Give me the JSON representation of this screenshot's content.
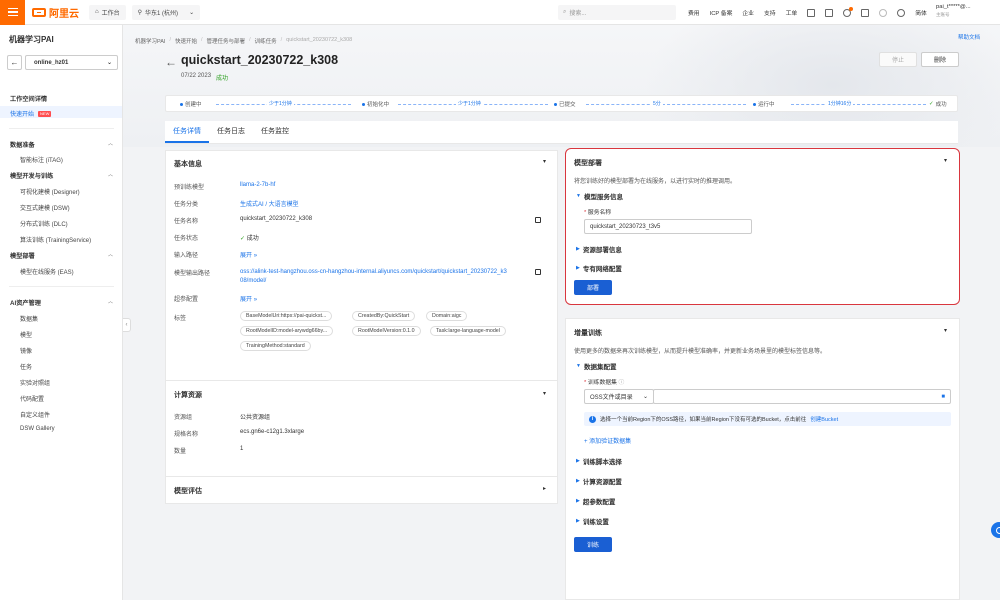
{
  "topbar": {
    "logo_text": "阿里云",
    "workbench": "工作台",
    "region": "华东1 (杭州)",
    "search_placeholder": "搜索...",
    "links": [
      "费用",
      "ICP 备案",
      "企业",
      "支持",
      "工单"
    ],
    "lang": "简体",
    "user_name": "pai_t*****@...",
    "user_sub": "主账号"
  },
  "sidebar": {
    "title": "机器学习PAI",
    "workspace": "online_hz01",
    "items": [
      {
        "label": "工作空间详情",
        "kind": "group"
      },
      {
        "label": "快速开始",
        "kind": "active",
        "badge": "NEW"
      },
      {
        "label": "数据准备",
        "kind": "group"
      },
      {
        "label": "智能标注 (iTAG)",
        "kind": "sub"
      },
      {
        "label": "模型开发与训练",
        "kind": "group"
      },
      {
        "label": "可视化建模 (Designer)",
        "kind": "sub"
      },
      {
        "label": "交互式建模 (DSW)",
        "kind": "sub"
      },
      {
        "label": "分布式训练 (DLC)",
        "kind": "sub"
      },
      {
        "label": "算法训练 (TrainingService)",
        "kind": "sub"
      },
      {
        "label": "模型部署",
        "kind": "group"
      },
      {
        "label": "模型在线服务 (EAS)",
        "kind": "sub"
      },
      {
        "label": "AI资产管理",
        "kind": "group"
      },
      {
        "label": "数据集",
        "kind": "sub"
      },
      {
        "label": "模型",
        "kind": "sub"
      },
      {
        "label": "镜像",
        "kind": "sub"
      },
      {
        "label": "任务",
        "kind": "sub"
      },
      {
        "label": "实验对照组",
        "kind": "sub"
      },
      {
        "label": "代码配置",
        "kind": "sub"
      },
      {
        "label": "自定义组件",
        "kind": "sub"
      },
      {
        "label": "DSW Gallery",
        "kind": "sub"
      }
    ]
  },
  "breadcrumb": [
    "机器学习PAI",
    "快速开始",
    "管理任务与部署",
    "训练任务",
    "quickstart_20230722_k308"
  ],
  "help_link": "帮助文档",
  "page": {
    "title": "quickstart_20230722_k308",
    "date": "07/22 2023",
    "status": "成功",
    "stop_label": "停止",
    "delete_label": "删除"
  },
  "timeline": {
    "steps": [
      "创建中",
      "初始化中",
      "已提交",
      "运行中",
      "成功"
    ],
    "durations": [
      "少于1分钟",
      "少于1分钟",
      "5分",
      "1分钟16分"
    ]
  },
  "tabs": [
    "任务详情",
    "任务日志",
    "任务监控"
  ],
  "basic_info": {
    "title": "基本信息",
    "rows": [
      {
        "k": "预训练模型",
        "v": "llama-2-7b-hf"
      },
      {
        "k": "任务分类",
        "v": "生成式AI / 大语言模型"
      },
      {
        "k": "任务名称",
        "v": "quickstart_20230722_k308"
      },
      {
        "k": "任务状态",
        "v": "成功"
      },
      {
        "k": "输入路径",
        "v": "展开"
      },
      {
        "k": "模型输出路径",
        "v": "oss://alink-test-hangzhou.oss-cn-hangzhou-internal.aliyuncs.com/quickstart/quickstart_20230722_k3",
        "v2": "08/model/"
      },
      {
        "k": "超参配置",
        "v": "展开"
      },
      {
        "k": "标签",
        "v": ""
      }
    ],
    "tags": [
      "BaseModelUri:https://pai-quickst...",
      "CreatedBy:QuickStart",
      "Domain:aigc",
      "RootModelID:model-arywdg66by...",
      "RootModelVersion:0.1.0",
      "Task:large-language-model",
      "TrainingMethod:standard"
    ]
  },
  "compute": {
    "title": "计算资源",
    "rows": [
      {
        "k": "资源组",
        "v": "公共资源组"
      },
      {
        "k": "规格名称",
        "v": "ecs.gn6e-c12g1.3xlarge"
      },
      {
        "k": "数量",
        "v": "1"
      }
    ]
  },
  "eval": {
    "title": "模型评估"
  },
  "deploy": {
    "title": "模型部署",
    "desc": "将您训练好的模型部署为在线服务，以进行实时的推理调用。",
    "section_service": "模型服务信息",
    "service_name_label": "服务名称",
    "service_name_value": "quickstart_20230723_t3v5",
    "section_resource": "资源部署信息",
    "section_network": "专有网络配置",
    "deploy_button": "部署"
  },
  "incremental": {
    "title": "增量训练",
    "desc": "使用更多的数据来再次训练模型，从而提升模型准确率，并更新业务场景里的模型标签信息等。",
    "section_dataset": "数据集配置",
    "dataset_label": "训练数据集",
    "dataset_source": "OSS文件或目录",
    "dataset_path": "",
    "info_text": "选择一个当前Region下的OSS路径，如果当前Region下没有可选的Bucket，点击前往",
    "info_link": "创建Bucket",
    "add_validation": "+ 添加验证数据集",
    "sections": [
      "训练脚本选择",
      "计算资源配置",
      "超参数配置",
      "训练设置"
    ],
    "train_button": "训练"
  }
}
